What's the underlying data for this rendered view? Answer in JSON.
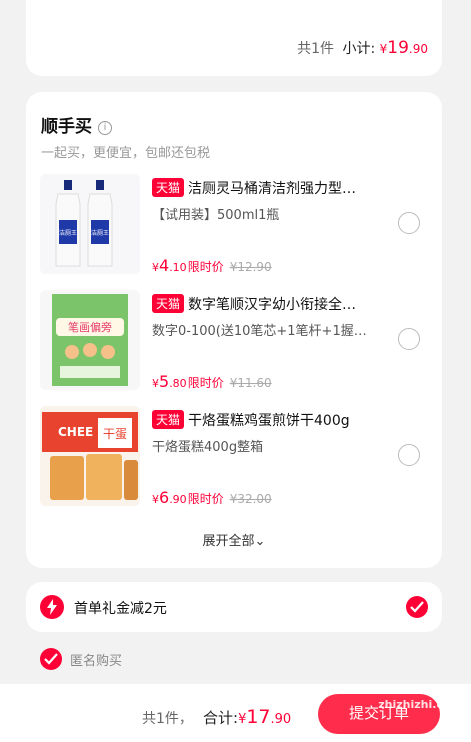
{
  "shop_summary": {
    "count_text": "共1件",
    "subtotal_label": "小计:",
    "currency": "¥",
    "subtotal_int": "19",
    "subtotal_dec": ".90"
  },
  "addon": {
    "title": "顺手买",
    "info_icon": "i",
    "subtitle": "一起买，更便宜，包邮还包税",
    "products": [
      {
        "tag": "天猫",
        "title": "洁厕灵马桶清洁剂强力型…",
        "spec": "【试用装】500ml1瓶",
        "currency": "¥",
        "price_int": "4",
        "price_dec": ".10",
        "price_label": "限时价",
        "old_price": "¥12.90",
        "thumb_text": "洁厕王"
      },
      {
        "tag": "天猫",
        "title": "数字笔顺汉字幼小衔接全…",
        "spec": "数字0-100(送10笔芯+1笔杆+1握…",
        "currency": "¥",
        "price_int": "5",
        "price_dec": ".80",
        "price_label": "限时价",
        "old_price": "¥11.60",
        "thumb_text": "笔画偏旁"
      },
      {
        "tag": "天猫",
        "title": "干烙蛋糕鸡蛋煎饼干400g",
        "spec": "干烙蛋糕400g整箱",
        "currency": "¥",
        "price_int": "6",
        "price_dec": ".90",
        "price_label": "限时价",
        "old_price": "¥32.00",
        "thumb_text": "干蛋"
      }
    ],
    "expand_label": "展开全部",
    "expand_icon": "⌄"
  },
  "coupon": {
    "label": "首单礼金减2元"
  },
  "anonymous": {
    "label": "匿名购买"
  },
  "footer": {
    "count_text": "共1件，",
    "total_label": "合计:",
    "currency": "¥",
    "total_int": "17",
    "total_dec": ".90",
    "submit_label": "提交订单"
  },
  "watermark": "zhizhizhi.com",
  "colors": {
    "accent": "#ff0036",
    "submit": "#ff2d4b",
    "background": "#f2f2f2"
  }
}
